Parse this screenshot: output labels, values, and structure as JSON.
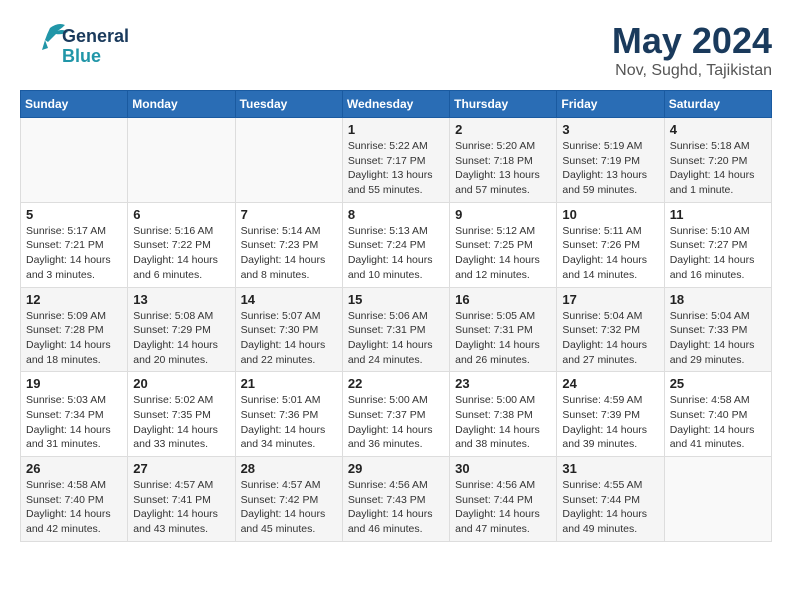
{
  "logo": {
    "line1": "General",
    "line2": "Blue"
  },
  "title": "May 2024",
  "subtitle": "Nov, Sughd, Tajikistan",
  "days_of_week": [
    "Sunday",
    "Monday",
    "Tuesday",
    "Wednesday",
    "Thursday",
    "Friday",
    "Saturday"
  ],
  "weeks": [
    [
      {
        "day": "",
        "info": ""
      },
      {
        "day": "",
        "info": ""
      },
      {
        "day": "",
        "info": ""
      },
      {
        "day": "1",
        "info": "Sunrise: 5:22 AM\nSunset: 7:17 PM\nDaylight: 13 hours\nand 55 minutes."
      },
      {
        "day": "2",
        "info": "Sunrise: 5:20 AM\nSunset: 7:18 PM\nDaylight: 13 hours\nand 57 minutes."
      },
      {
        "day": "3",
        "info": "Sunrise: 5:19 AM\nSunset: 7:19 PM\nDaylight: 13 hours\nand 59 minutes."
      },
      {
        "day": "4",
        "info": "Sunrise: 5:18 AM\nSunset: 7:20 PM\nDaylight: 14 hours\nand 1 minute."
      }
    ],
    [
      {
        "day": "5",
        "info": "Sunrise: 5:17 AM\nSunset: 7:21 PM\nDaylight: 14 hours\nand 3 minutes."
      },
      {
        "day": "6",
        "info": "Sunrise: 5:16 AM\nSunset: 7:22 PM\nDaylight: 14 hours\nand 6 minutes."
      },
      {
        "day": "7",
        "info": "Sunrise: 5:14 AM\nSunset: 7:23 PM\nDaylight: 14 hours\nand 8 minutes."
      },
      {
        "day": "8",
        "info": "Sunrise: 5:13 AM\nSunset: 7:24 PM\nDaylight: 14 hours\nand 10 minutes."
      },
      {
        "day": "9",
        "info": "Sunrise: 5:12 AM\nSunset: 7:25 PM\nDaylight: 14 hours\nand 12 minutes."
      },
      {
        "day": "10",
        "info": "Sunrise: 5:11 AM\nSunset: 7:26 PM\nDaylight: 14 hours\nand 14 minutes."
      },
      {
        "day": "11",
        "info": "Sunrise: 5:10 AM\nSunset: 7:27 PM\nDaylight: 14 hours\nand 16 minutes."
      }
    ],
    [
      {
        "day": "12",
        "info": "Sunrise: 5:09 AM\nSunset: 7:28 PM\nDaylight: 14 hours\nand 18 minutes."
      },
      {
        "day": "13",
        "info": "Sunrise: 5:08 AM\nSunset: 7:29 PM\nDaylight: 14 hours\nand 20 minutes."
      },
      {
        "day": "14",
        "info": "Sunrise: 5:07 AM\nSunset: 7:30 PM\nDaylight: 14 hours\nand 22 minutes."
      },
      {
        "day": "15",
        "info": "Sunrise: 5:06 AM\nSunset: 7:31 PM\nDaylight: 14 hours\nand 24 minutes."
      },
      {
        "day": "16",
        "info": "Sunrise: 5:05 AM\nSunset: 7:31 PM\nDaylight: 14 hours\nand 26 minutes."
      },
      {
        "day": "17",
        "info": "Sunrise: 5:04 AM\nSunset: 7:32 PM\nDaylight: 14 hours\nand 27 minutes."
      },
      {
        "day": "18",
        "info": "Sunrise: 5:04 AM\nSunset: 7:33 PM\nDaylight: 14 hours\nand 29 minutes."
      }
    ],
    [
      {
        "day": "19",
        "info": "Sunrise: 5:03 AM\nSunset: 7:34 PM\nDaylight: 14 hours\nand 31 minutes."
      },
      {
        "day": "20",
        "info": "Sunrise: 5:02 AM\nSunset: 7:35 PM\nDaylight: 14 hours\nand 33 minutes."
      },
      {
        "day": "21",
        "info": "Sunrise: 5:01 AM\nSunset: 7:36 PM\nDaylight: 14 hours\nand 34 minutes."
      },
      {
        "day": "22",
        "info": "Sunrise: 5:00 AM\nSunset: 7:37 PM\nDaylight: 14 hours\nand 36 minutes."
      },
      {
        "day": "23",
        "info": "Sunrise: 5:00 AM\nSunset: 7:38 PM\nDaylight: 14 hours\nand 38 minutes."
      },
      {
        "day": "24",
        "info": "Sunrise: 4:59 AM\nSunset: 7:39 PM\nDaylight: 14 hours\nand 39 minutes."
      },
      {
        "day": "25",
        "info": "Sunrise: 4:58 AM\nSunset: 7:40 PM\nDaylight: 14 hours\nand 41 minutes."
      }
    ],
    [
      {
        "day": "26",
        "info": "Sunrise: 4:58 AM\nSunset: 7:40 PM\nDaylight: 14 hours\nand 42 minutes."
      },
      {
        "day": "27",
        "info": "Sunrise: 4:57 AM\nSunset: 7:41 PM\nDaylight: 14 hours\nand 43 minutes."
      },
      {
        "day": "28",
        "info": "Sunrise: 4:57 AM\nSunset: 7:42 PM\nDaylight: 14 hours\nand 45 minutes."
      },
      {
        "day": "29",
        "info": "Sunrise: 4:56 AM\nSunset: 7:43 PM\nDaylight: 14 hours\nand 46 minutes."
      },
      {
        "day": "30",
        "info": "Sunrise: 4:56 AM\nSunset: 7:44 PM\nDaylight: 14 hours\nand 47 minutes."
      },
      {
        "day": "31",
        "info": "Sunrise: 4:55 AM\nSunset: 7:44 PM\nDaylight: 14 hours\nand 49 minutes."
      },
      {
        "day": "",
        "info": ""
      }
    ]
  ]
}
